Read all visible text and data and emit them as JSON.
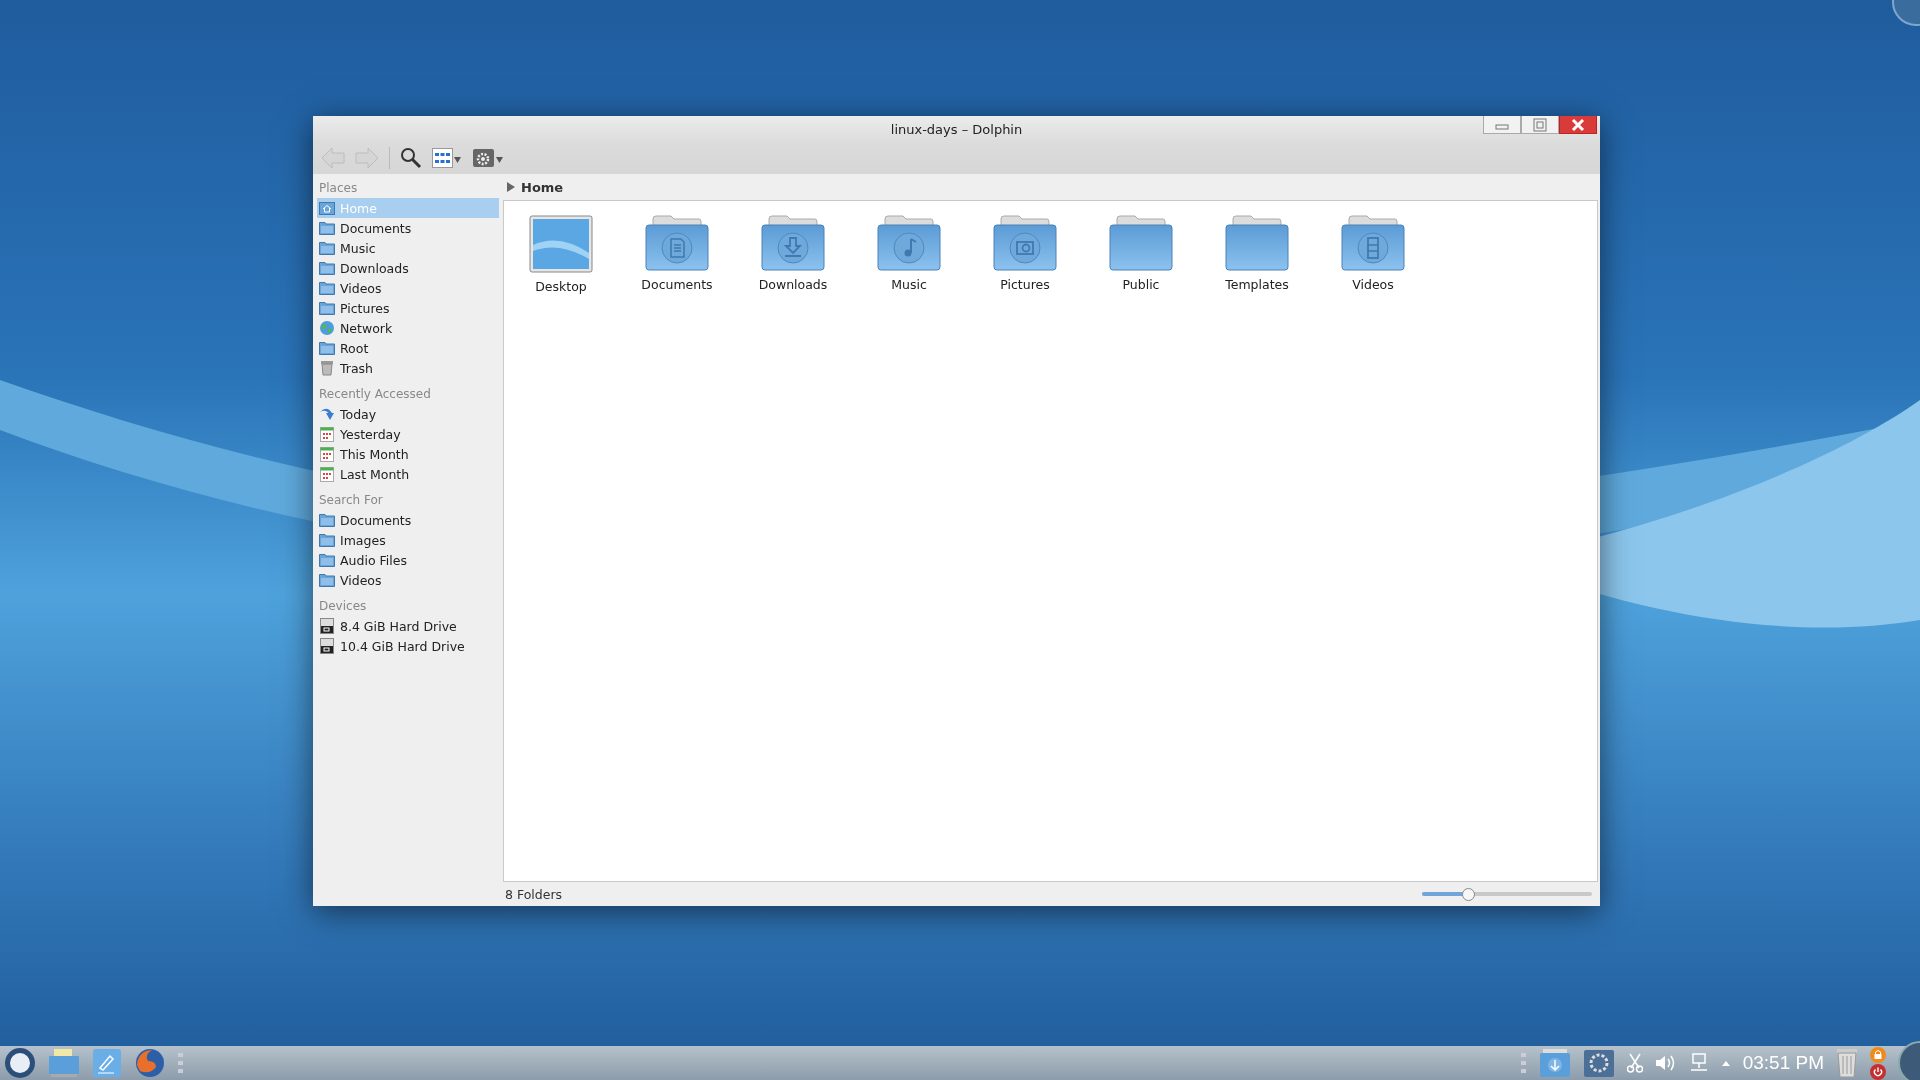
{
  "window": {
    "title": "linux-days – Dolphin"
  },
  "toolbar": {
    "back": {
      "disabled": true
    },
    "forward": {
      "disabled": true
    }
  },
  "sidebar": {
    "sections": [
      {
        "title": "Places",
        "items": [
          {
            "label": "Home",
            "kind": "home",
            "selected": true
          },
          {
            "label": "Documents",
            "kind": "folder",
            "selected": false
          },
          {
            "label": "Music",
            "kind": "folder",
            "selected": false
          },
          {
            "label": "Downloads",
            "kind": "folder",
            "selected": false
          },
          {
            "label": "Videos",
            "kind": "folder",
            "selected": false
          },
          {
            "label": "Pictures",
            "kind": "folder",
            "selected": false
          },
          {
            "label": "Network",
            "kind": "globe",
            "selected": false
          },
          {
            "label": "Root",
            "kind": "folder",
            "selected": false
          },
          {
            "label": "Trash",
            "kind": "trash",
            "selected": false
          }
        ]
      },
      {
        "title": "Recently Accessed",
        "items": [
          {
            "label": "Today",
            "kind": "arrow",
            "selected": false
          },
          {
            "label": "Yesterday",
            "kind": "calendar",
            "selected": false
          },
          {
            "label": "This Month",
            "kind": "calendar",
            "selected": false
          },
          {
            "label": "Last Month",
            "kind": "calendar",
            "selected": false
          }
        ]
      },
      {
        "title": "Search For",
        "items": [
          {
            "label": "Documents",
            "kind": "folder",
            "selected": false
          },
          {
            "label": "Images",
            "kind": "folder",
            "selected": false
          },
          {
            "label": "Audio Files",
            "kind": "folder",
            "selected": false
          },
          {
            "label": "Videos",
            "kind": "folder",
            "selected": false
          }
        ]
      },
      {
        "title": "Devices",
        "items": [
          {
            "label": "8.4 GiB Hard Drive",
            "kind": "drive",
            "selected": false
          },
          {
            "label": "10.4 GiB Hard Drive",
            "kind": "drive",
            "selected": false
          }
        ]
      }
    ]
  },
  "breadcrumb": {
    "location": "Home"
  },
  "files": [
    {
      "name": "Desktop",
      "kind": "desktop"
    },
    {
      "name": "Documents",
      "kind": "documents"
    },
    {
      "name": "Downloads",
      "kind": "downloads"
    },
    {
      "name": "Music",
      "kind": "music"
    },
    {
      "name": "Pictures",
      "kind": "pictures"
    },
    {
      "name": "Public",
      "kind": "plain"
    },
    {
      "name": "Templates",
      "kind": "plain"
    },
    {
      "name": "Videos",
      "kind": "videos"
    }
  ],
  "status_bar": {
    "summary": "8 Folders",
    "zoom": {
      "level": 0.27
    }
  },
  "taskbar": {
    "clock": "03:51 PM"
  }
}
